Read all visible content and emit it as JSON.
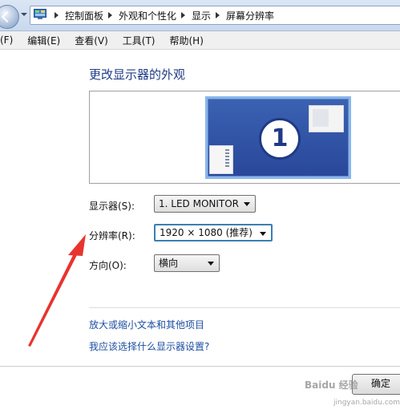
{
  "address_bar": {
    "crumbs": [
      "控制面板",
      "外观和个性化",
      "显示",
      "屏幕分辨率"
    ]
  },
  "menu": {
    "items": [
      "(F)",
      "编辑(E)",
      "查看(V)",
      "工具(T)",
      "帮助(H)"
    ]
  },
  "page": {
    "title": "更改显示器的外观",
    "monitor_number": "1"
  },
  "form": {
    "display": {
      "label": "显示器(S):",
      "value": "1. LED MONITOR"
    },
    "resolution": {
      "label": "分辨率(R):",
      "value": "1920 × 1080 (推荐)"
    },
    "orientation": {
      "label": "方向(O):",
      "value": "横向"
    }
  },
  "links": {
    "text_size": "放大或缩小文本和其他项目",
    "which_settings": "我应该选择什么显示器设置?"
  },
  "buttons": {
    "ok": "确定"
  },
  "watermark": {
    "text": "Baidu 经验",
    "url": "jingyan.baidu.com"
  },
  "colors": {
    "annotation_arrow": "#e8342f",
    "link": "#1e4fa0",
    "title": "#1e3b87"
  }
}
